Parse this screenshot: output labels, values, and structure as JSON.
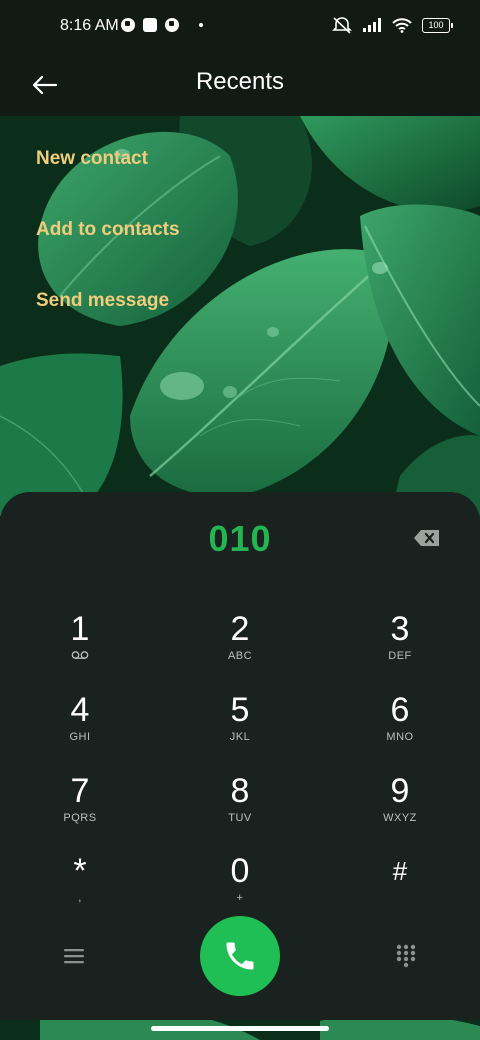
{
  "status_bar": {
    "time": "8:16 AM",
    "battery": "100",
    "left_icons": [
      "notification-icon",
      "square-notification-icon",
      "notification-icon"
    ],
    "right_icons": [
      "mute-icon",
      "signal-icon",
      "wifi-icon",
      "battery-icon"
    ]
  },
  "header": {
    "title": "Recents",
    "back_icon": "arrow-left-icon"
  },
  "actions": [
    {
      "label": "New contact"
    },
    {
      "label": "Add to contacts"
    },
    {
      "label": "Send message"
    }
  ],
  "dialer": {
    "number": "010",
    "backspace_icon": "backspace-icon",
    "keys": [
      {
        "digit": "1",
        "letters": "",
        "sub_icon": "voicemail-icon"
      },
      {
        "digit": "2",
        "letters": "ABC"
      },
      {
        "digit": "3",
        "letters": "DEF"
      },
      {
        "digit": "4",
        "letters": "GHI"
      },
      {
        "digit": "5",
        "letters": "JKL"
      },
      {
        "digit": "6",
        "letters": "MNO"
      },
      {
        "digit": "7",
        "letters": "PQRS"
      },
      {
        "digit": "8",
        "letters": "TUV"
      },
      {
        "digit": "9",
        "letters": "WXYZ"
      },
      {
        "digit": "*",
        "letters": ","
      },
      {
        "digit": "0",
        "letters": "+"
      },
      {
        "digit": "#",
        "letters": ""
      }
    ],
    "bottom": {
      "menu_icon": "menu-icon",
      "call_icon": "phone-icon",
      "keypad_icon": "keypad-icon"
    }
  },
  "colors": {
    "accent": "#24b552",
    "call_button": "#1fbf55",
    "action_text": "#f0cd7c",
    "panel": "#19221e"
  }
}
